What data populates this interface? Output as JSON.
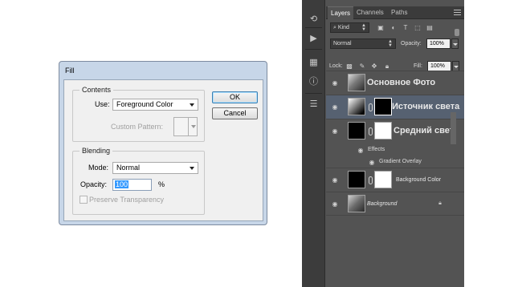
{
  "fill_dialog": {
    "title": "Fill",
    "contents": {
      "group_title": "Contents",
      "use_label": "Use:",
      "use_value": "Foreground Color",
      "custom_pattern_label": "Custom Pattern:"
    },
    "blending": {
      "group_title": "Blending",
      "mode_label": "Mode:",
      "mode_value": "Normal",
      "opacity_label": "Opacity:",
      "opacity_value": "100",
      "opacity_unit": "%",
      "preserve_label": "Preserve Transparency",
      "preserve_checked": false
    },
    "ok_label": "OK",
    "cancel_label": "Cancel"
  },
  "layers_panel": {
    "tabs": [
      {
        "label": "Layers",
        "active": true
      },
      {
        "label": "Channels",
        "active": false
      },
      {
        "label": "Paths",
        "active": false
      }
    ],
    "filter_kind": "Kind",
    "blend_mode": "Normal",
    "opacity_label": "Opacity:",
    "opacity_value": "100%",
    "lock_label": "Lock:",
    "fill_label": "Fill:",
    "fill_value": "100%",
    "layers": [
      {
        "name": "Основное Фото",
        "style": "big"
      },
      {
        "name": "Источник света",
        "style": "big",
        "selected": true
      },
      {
        "name": "Средний свет",
        "style": "big",
        "effects_label": "Effects",
        "effect": "Gradient Overlay"
      },
      {
        "name": "Background Color",
        "style": "small"
      },
      {
        "name": "Background",
        "style": "small-italic",
        "locked": true
      }
    ]
  },
  "colors": {
    "dialog_frame": "#c7d6e8",
    "ps_panel": "#535353",
    "selected_layer": "#566171",
    "selection_blue": "#3399ff"
  }
}
